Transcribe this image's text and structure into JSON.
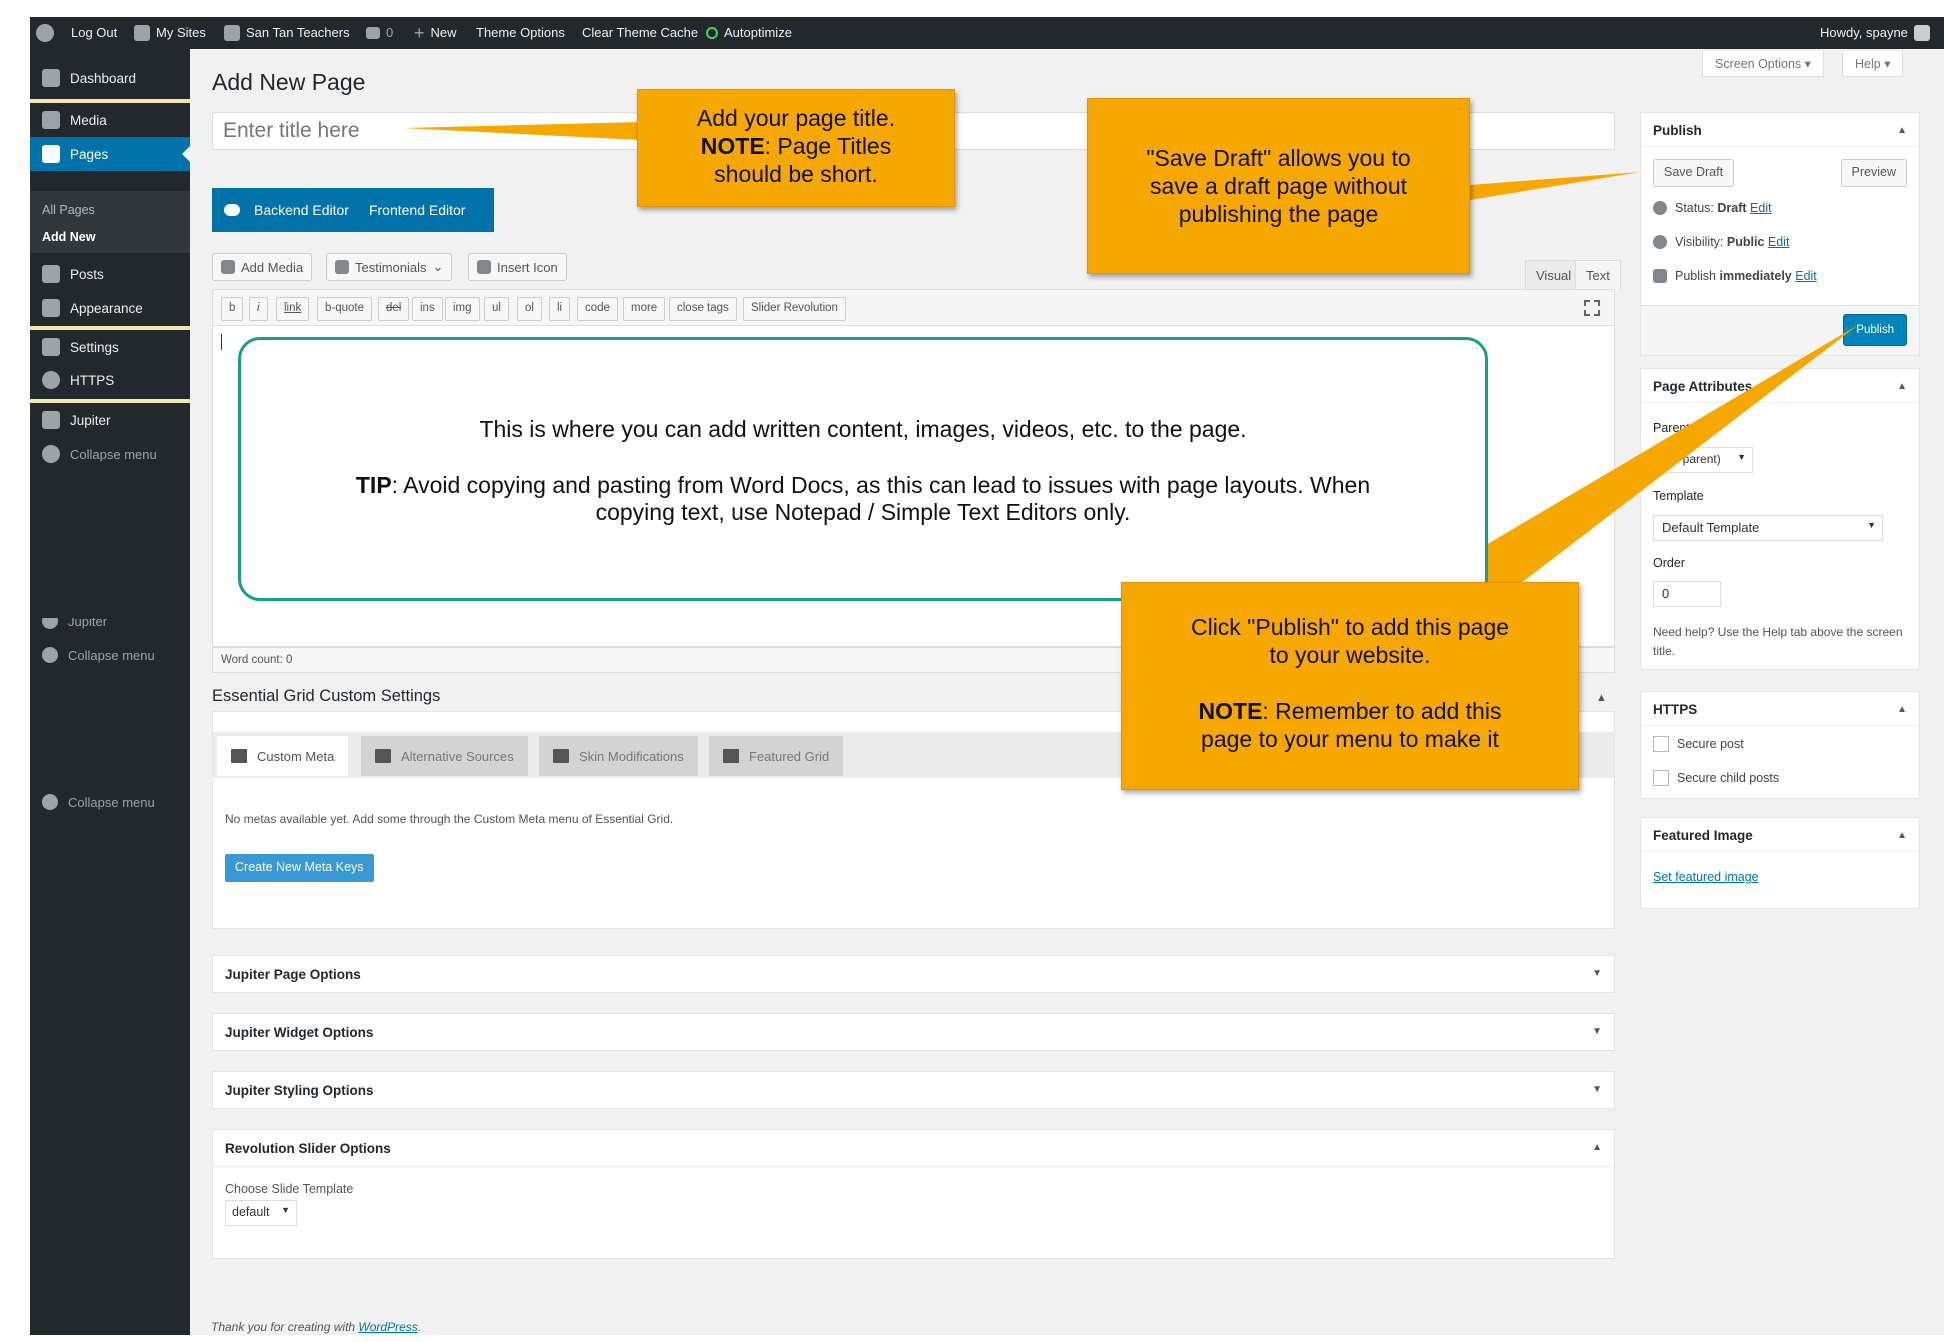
{
  "admin_bar": {
    "logout": "Log Out",
    "my_sites": "My Sites",
    "site_name": "San Tan Teachers",
    "comments_count": "0",
    "new": "New",
    "theme_options": "Theme Options",
    "clear_cache": "Clear Theme Cache",
    "autoptimize": "Autoptimize",
    "howdy": "Howdy, spayne"
  },
  "sidebar": {
    "dashboard": "Dashboard",
    "media": "Media",
    "pages": "Pages",
    "all_pages": "All Pages",
    "add_new": "Add New",
    "posts": "Posts",
    "appearance": "Appearance",
    "settings": "Settings",
    "https": "HTTPS",
    "jupiter": "Jupiter",
    "collapse": "Collapse menu",
    "ghost_jupiter": "Jupiter"
  },
  "screen_options": "Screen Options",
  "help": "Help",
  "page_title": "Add New Page",
  "title_placeholder": "Enter title here",
  "editor_buttons": {
    "backend": "Backend Editor",
    "frontend": "Frontend Editor"
  },
  "media_buttons": {
    "add_media": "Add Media",
    "testimonials": "Testimonials",
    "insert_icon": "Insert Icon"
  },
  "editor_tabs": {
    "visual": "Visual",
    "text": "Text"
  },
  "quicktags": [
    "b",
    "i",
    "link",
    "b-quote",
    "del",
    "ins",
    "img",
    "ul",
    "ol",
    "li",
    "code",
    "more",
    "close tags",
    "Slider Revolution"
  ],
  "word_count": "Word count: 0",
  "essential_grid": {
    "heading": "Essential Grid Custom Settings",
    "tabs": [
      "Custom Meta",
      "Alternative Sources",
      "Skin Modifications",
      "Featured Grid"
    ],
    "message": "No metas available yet. Add some through the Custom Meta menu of Essential Grid.",
    "create_button": "Create New Meta Keys"
  },
  "panels": {
    "jupiter_page": "Jupiter Page Options",
    "jupiter_widget": "Jupiter Widget Options",
    "jupiter_styling": "Jupiter Styling Options",
    "revolution_slider": "Revolution Slider Options",
    "choose_slide_label": "Choose Slide Template",
    "choose_slide_value": "default"
  },
  "footer": {
    "text": "Thank you for creating with ",
    "link": "WordPress",
    "end": "."
  },
  "publish_box": {
    "heading": "Publish",
    "save_draft": "Save Draft",
    "preview": "Preview",
    "status_label": "Status: ",
    "status_value": "Draft",
    "visibility_label": "Visibility: ",
    "visibility_value": "Public",
    "publish_label": "Publish ",
    "publish_value": "immediately",
    "edit": "Edit",
    "publish_button": "Publish"
  },
  "page_attributes": {
    "heading": "Page Attributes",
    "parent_label": "Parent",
    "parent_value": "(no parent)",
    "template_label": "Template",
    "template_value": "Default Template",
    "order_label": "Order",
    "order_value": "0",
    "help_text": "Need help? Use the Help tab above the screen title."
  },
  "https_box": {
    "heading": "HTTPS",
    "secure_post": "Secure post",
    "secure_child": "Secure child posts"
  },
  "featured_image": {
    "heading": "Featured Image",
    "link": "Set featured image"
  },
  "callouts": {
    "title_line1": "Add your page title.",
    "title_note": "NOTE",
    "title_line2": ": Page Titles",
    "title_line3": "should be short.",
    "draft_line1": "\"Save Draft\" allows you to",
    "draft_line2": "save a draft page without",
    "draft_line3": "publishing the page",
    "publish_line1": "Click \"Publish\" to add this page",
    "publish_line2": "to your website.",
    "publish_note": "NOTE",
    "publish_line3": ": Remember to add this",
    "publish_line4": "page to your menu to make it",
    "tip_line1": "This is where you can add written content, images, videos, etc. to the page.",
    "tip_label": "TIP",
    "tip_line2": ": Avoid copying and pasting from Word Docs, as this can lead to issues with page layouts. When",
    "tip_line3": "copying text, use Notepad / Simple Text Editors only."
  },
  "colors": {
    "admin_bar": "#23282d",
    "accent": "#0073aa",
    "callout": "#f7a800",
    "tip_border": "#15a08e"
  }
}
